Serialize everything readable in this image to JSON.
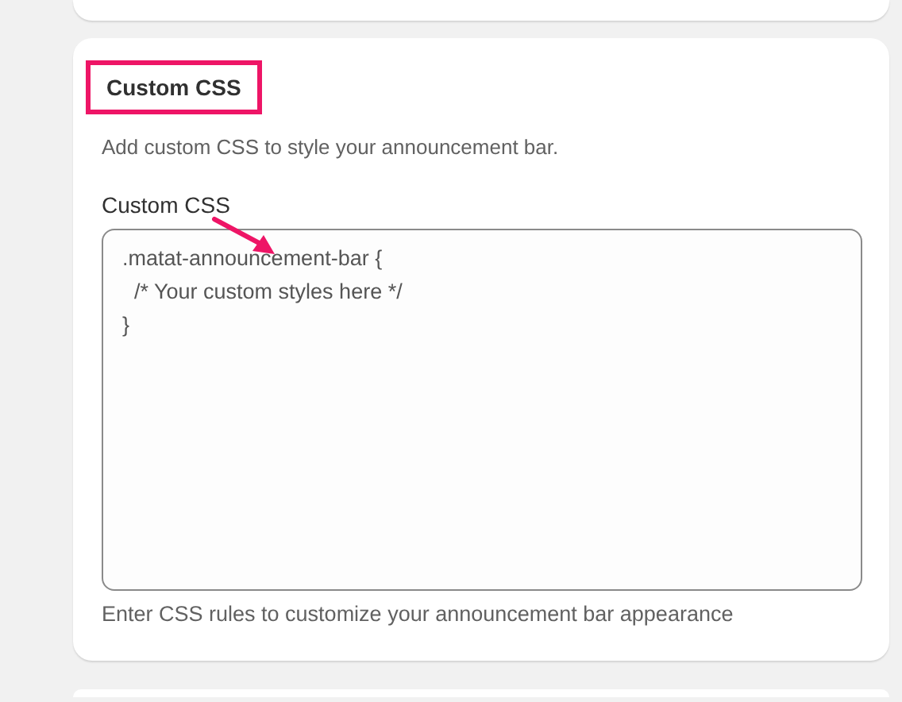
{
  "section": {
    "title": "Custom CSS",
    "title_highlighted": true,
    "description": "Add custom CSS to style your announcement bar.",
    "field": {
      "label": "Custom CSS",
      "value": ".matat-announcement-bar {\n  /* Your custom styles here */\n}",
      "help": "Enter CSS rules to customize your announcement bar appearance",
      "arrow_pointer": true
    }
  }
}
